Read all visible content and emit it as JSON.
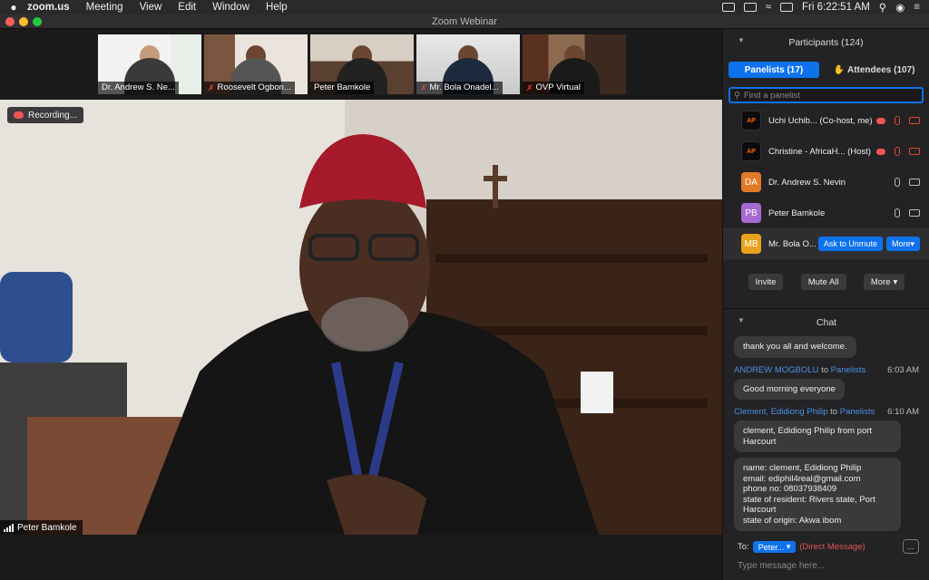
{
  "menubar": {
    "apple": "",
    "items": [
      "zoom.us",
      "Meeting",
      "View",
      "Edit",
      "Window",
      "Help"
    ],
    "clock": "Fri 6:22:51 AM"
  },
  "window": {
    "title": "Zoom Webinar"
  },
  "thumbnails": [
    {
      "name": "Dr. Andrew S. Ne...",
      "muted": false
    },
    {
      "name": "Roosevelt Ogbon...",
      "muted": true
    },
    {
      "name": "Peter Bamkole",
      "muted": false
    },
    {
      "name": "Mr. Bola Onadel...",
      "muted": true
    },
    {
      "name": "OVP Virtual",
      "muted": true
    }
  ],
  "video": {
    "recording": "Recording...",
    "speaker": "Peter Bamkole"
  },
  "participants": {
    "header": "Participants (124)",
    "tab_panelists": "Panelists (17)",
    "tab_attendees": "Attendees (107)",
    "search_placeholder": "Find a panelist",
    "rows": [
      {
        "initials": "AP",
        "name": "Uchi Uchib...  (Co-host, me)"
      },
      {
        "initials": "AP",
        "name": "Christine - AfricaH...  (Host)"
      },
      {
        "initials": "DA",
        "name": "Dr. Andrew S. Nevin",
        "color": "#e57a26"
      },
      {
        "initials": "PB",
        "name": "Peter Bamkole",
        "color": "#a66bd1"
      },
      {
        "initials": "MB",
        "name": "Mr. Bola O...",
        "color": "#e8a31c"
      }
    ],
    "ask_unmute": "Ask to Unmute",
    "more": "More",
    "invite": "Invite",
    "mute_all": "Mute All",
    "more2": "More"
  },
  "chat": {
    "header": "Chat",
    "msg0": "thank you all and welcome.",
    "m1_sender": "ANDREW MOGBOLU",
    "m1_to": "to",
    "m1_target": "Panelists",
    "m1_time": "6:03 AM",
    "m1_text": "Good morning everyone",
    "m2_sender": "Clement, Edidiong Philip",
    "m2_to": "to",
    "m2_target": "Panelists",
    "m2_time": "6:10 AM",
    "m2_text": "clement, Edidiong Philip from port Harcourt",
    "m3_lines": [
      "name: clement, Edidiong Philip",
      "email: ediphil4real@gmail.com",
      "phone no: 08037938409",
      "state of resident: Rivers state, Port Harcourt",
      "state of origin: Akwa ibom"
    ],
    "to_label": "To:",
    "to_select": "Peter...",
    "direct": "(Direct Message)",
    "input_placeholder": "Type message here...",
    "more_dots": "..."
  },
  "colors": {
    "accent": "#0e72ed",
    "muted": "#e0443a",
    "active_border": "#d9d23a"
  }
}
